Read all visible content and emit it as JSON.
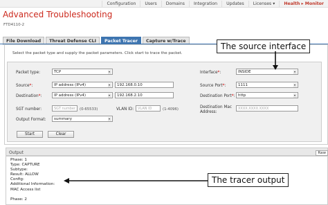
{
  "topnav": {
    "items": [
      "Configuration",
      "Users",
      "Domains",
      "Integration",
      "Updates",
      "Licenses ▾"
    ],
    "health_monitor": "Health ▸ Monitor"
  },
  "page": {
    "title": "Advanced Troubleshooting",
    "device": "FTD4110-2"
  },
  "tabs": [
    "File Download",
    "Threat Defense CLI",
    "Packet Tracer",
    "Capture w/Trace"
  ],
  "instructions": "Select the packet type and supply the packet parameters. Click start to trace the packet.",
  "form": {
    "packet_type_label": "Packet type:",
    "packet_type_value": "TCP",
    "source_label": "Source",
    "source_type": "IP address (IPv4)",
    "source_ip": "192.168.0.10",
    "destination_label": "Destination",
    "destination_type": "IP address (IPv4)",
    "destination_ip": "192.168.2.10",
    "sgt_label": "SGT number:",
    "sgt_placeholder": "SGT number",
    "sgt_hint": "(0-65533)",
    "vlan_label": "VLAN ID:",
    "vlan_placeholder": "VLAN ID",
    "vlan_hint": "(1-4096)",
    "output_format_label": "Output Format:",
    "output_format_value": "summary",
    "interface_label": "Interface",
    "interface_value": "INSIDE",
    "source_port_label": "Source Port",
    "source_port_value": "1111",
    "destination_port_label": "Destination Port",
    "destination_port_value": "http",
    "dest_mac_label_1": "Destination Mac",
    "dest_mac_label_2": "Address:",
    "dest_mac_placeholder": "XXXX.XXXX.XXXX",
    "required_mark": "*",
    "colon": ":",
    "start_label": "Start",
    "clear_label": "Clear"
  },
  "output": {
    "header": "Output",
    "raw_label": "Raw",
    "lines": [
      "Phase: 1",
      "Type: CAPTURE",
      "Subtype:",
      "Result: ALLOW",
      "Config:",
      "Additional Information:",
      "MAC Access list",
      "",
      "Phase: 2"
    ]
  },
  "callouts": {
    "source_interface": "The source interface",
    "tracer_output": "The tracer output"
  },
  "colors": {
    "title": "#cc2a1e",
    "tab_active": "#3e75b0"
  }
}
